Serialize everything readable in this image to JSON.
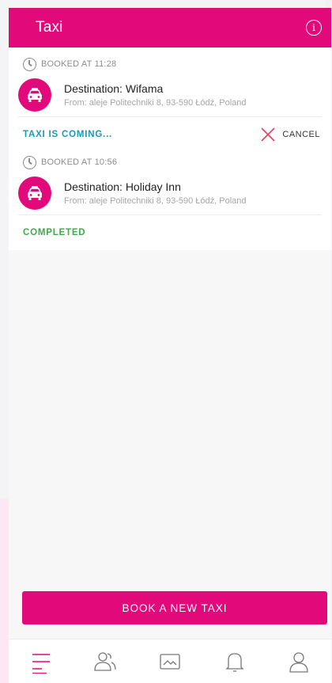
{
  "header": {
    "title": "Taxi",
    "info_icon": "info-icon"
  },
  "bookings": [
    {
      "booked_at": "BOOKED AT 11:28",
      "destination": "Destination: Wifama",
      "from": "From: aleje Politechniki 8, 93-590 Łódź, Poland",
      "status": "TAXI IS COMING...",
      "action": "CANCEL"
    },
    {
      "booked_at": "BOOKED AT 10:56",
      "destination": "Destination: Holiday Inn",
      "from": "From: aleje Politechniki 8, 93-590 Łódź, Poland",
      "status": "COMPLETED"
    }
  ],
  "book_button": "BOOK A NEW TAXI",
  "nav": [
    "menu-icon",
    "people-icon",
    "gallery-icon",
    "bell-icon",
    "profile-icon"
  ],
  "colors": {
    "accent": "#e2097a",
    "coming": "#1a9ab5",
    "completed": "#3faa4a",
    "cancel_x": "#e2435a"
  }
}
